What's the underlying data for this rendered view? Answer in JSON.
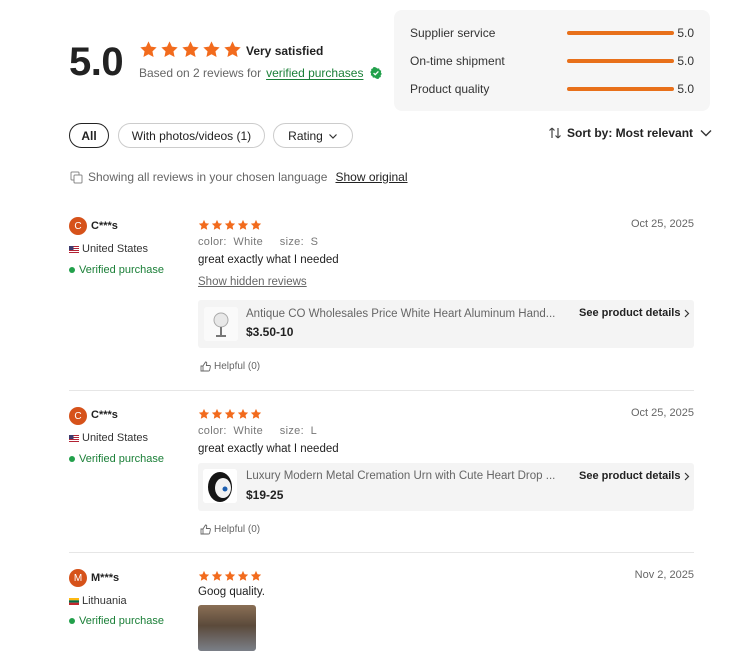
{
  "summary": {
    "score": "5.0",
    "satisfaction": "Very satisfied",
    "based_on": "Based on 2 reviews for",
    "verified_link": "verified purchases",
    "star_color": "#f26b1d"
  },
  "metrics": [
    {
      "name": "Supplier service",
      "value": "5.0",
      "fill": 1.0
    },
    {
      "name": "On-time shipment",
      "value": "5.0",
      "fill": 1.0
    },
    {
      "name": "Product quality",
      "value": "5.0",
      "fill": 1.0
    }
  ],
  "filters": {
    "all": "All",
    "photos": "With photos/videos (1)",
    "rating": "Rating",
    "sort": "Sort by: Most relevant"
  },
  "language": {
    "note": "Showing all reviews in your chosen language",
    "show_original": "Show original"
  },
  "reviews": [
    {
      "initial": "C",
      "name": "C***s",
      "country": "United States",
      "verified": "Verified purchase",
      "date": "Oct 25, 2025",
      "rating": 5,
      "attrs": "color:  White     size:  S",
      "text": "great exactly what I needed",
      "hidden_link": "Show hidden reviews",
      "product": {
        "title": "Antique CO Wholesales Price White Heart Aluminum Hand...",
        "price": "$3.50-10",
        "details": "See product details"
      },
      "helpful": "Helpful (0)"
    },
    {
      "initial": "C",
      "name": "C***s",
      "country": "United States",
      "verified": "Verified purchase",
      "date": "Oct 25, 2025",
      "rating": 5,
      "attrs": "color:  White     size:  L",
      "text": "great exactly what I needed",
      "product": {
        "title": "Luxury Modern Metal Cremation Urn with Cute Heart Drop ...",
        "price": "$19-25",
        "details": "See product details"
      },
      "helpful": "Helpful (0)"
    },
    {
      "initial": "M",
      "name": "M***s",
      "country": "Lithuania",
      "verified": "Verified purchase",
      "date": "Nov 2, 2025",
      "rating": 5,
      "text": "Goog quality."
    }
  ]
}
